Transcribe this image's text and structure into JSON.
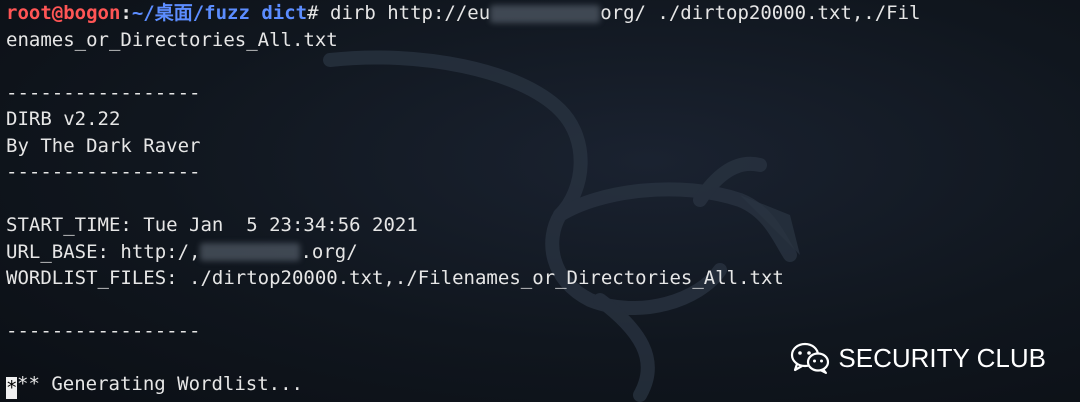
{
  "prompt": {
    "user": "root@bogon",
    "separator": ":",
    "path": "~/桌面/fuzz dict",
    "symbol": "#"
  },
  "command_part1": "dirb http://eu",
  "command_part2": "org/ ./dirtop20000.txt,./Fil",
  "command_wrap": "enames_or_Directories_All.txt",
  "separator_line": "-----------------",
  "version": "DIRB v2.22",
  "author": "By The Dark Raver",
  "start_time": "START_TIME: Tue Jan  5 23:34:56 2021",
  "url_base_part1": "URL_BASE: http:/,",
  "url_base_part2": ".org/",
  "wordlist_files": "WORDLIST_FILES: ./dirtop20000.txt,./Filenames_or_Directories_All.txt",
  "cursor_char": "*",
  "generating": "** Generating Wordlist...",
  "watermark": {
    "text": "SECURITY CLUB",
    "icon": "wechat-icon"
  },
  "colors": {
    "prompt_user": "#ff5555",
    "prompt_path": "#5c8dff",
    "text": "#e6e6e6",
    "background": "#10161e"
  }
}
